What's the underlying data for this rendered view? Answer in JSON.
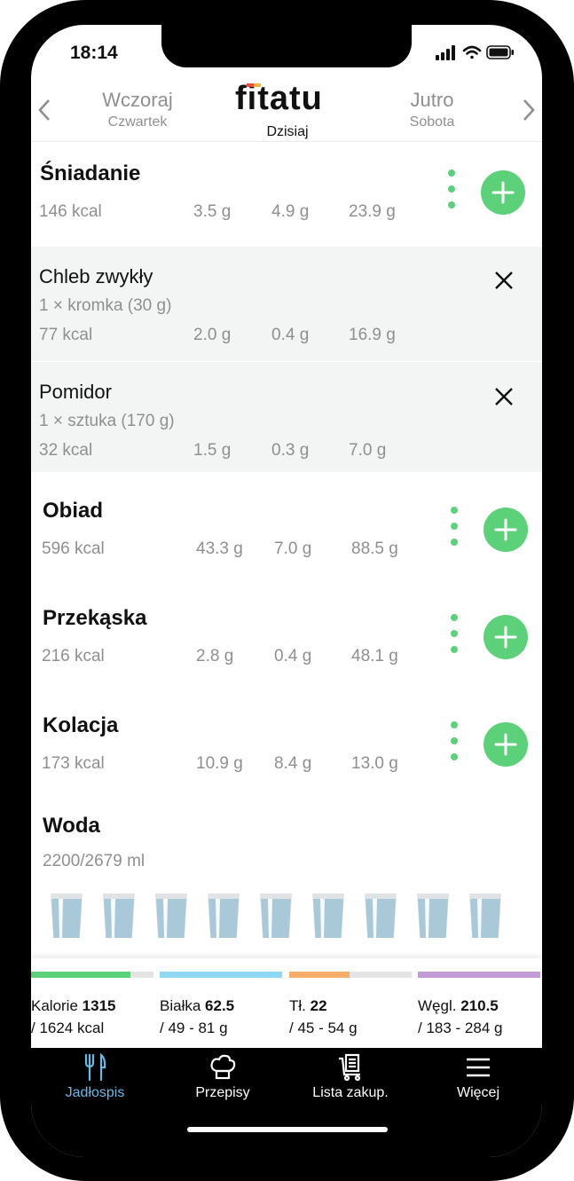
{
  "status_bar": {
    "time": "18:14"
  },
  "header": {
    "prev_day": {
      "name": "Wczoraj",
      "sub": "Czwartek"
    },
    "next_day": {
      "name": "Jutro",
      "sub": "Sobota"
    },
    "logo_text": "fitatu",
    "today_label": "Dzisiaj"
  },
  "meals": {
    "breakfast": {
      "title": "Śniadanie",
      "kcal": "146 kcal",
      "protein": "3.5 g",
      "fat": "4.9 g",
      "carbs": "23.9 g"
    },
    "lunch": {
      "title": "Obiad",
      "kcal": "596 kcal",
      "protein": "43.3 g",
      "fat": "7.0 g",
      "carbs": "88.5 g"
    },
    "snack": {
      "title": "Przekąska",
      "kcal": "216 kcal",
      "protein": "2.8 g",
      "fat": "0.4 g",
      "carbs": "48.1 g"
    },
    "dinner": {
      "title": "Kolacja",
      "kcal": "173 kcal",
      "protein": "10.9 g",
      "fat": "8.4 g",
      "carbs": "13.0 g"
    }
  },
  "breakfast_items": [
    {
      "name": "Chleb zwykły",
      "portion": "1 × kromka (30 g)",
      "kcal": "77 kcal",
      "protein": "2.0 g",
      "fat": "0.4 g",
      "carbs": "16.9 g"
    },
    {
      "name": "Pomidor",
      "portion": "1 × sztuka (170 g)",
      "kcal": "32 kcal",
      "protein": "1.5 g",
      "fat": "0.3 g",
      "carbs": "7.0 g"
    }
  ],
  "water": {
    "title": "Woda",
    "value": "2200/2679 ml",
    "glasses_total": 9,
    "glasses_filled": 9
  },
  "summary": {
    "calories": {
      "label": "Kalorie",
      "value": "1315",
      "range": "/ 1624 kcal",
      "progress": 0.81,
      "color": "#5dd07a"
    },
    "protein": {
      "label": "Białka",
      "value": "62.5",
      "range": "/ 49 - 81 g",
      "progress": 1.0,
      "color": "#8ed8f5"
    },
    "fat": {
      "label": "Tł.",
      "value": "22",
      "range": "/ 45 - 54 g",
      "progress": 0.49,
      "color": "#f6ad6c"
    },
    "carbs": {
      "label": "Węgl.",
      "value": "210.5",
      "range": "/ 183 - 284 g",
      "progress": 1.0,
      "color": "#c39ad8"
    }
  },
  "tabs": [
    {
      "label": "Jadłospis",
      "icon": "fork-knife-icon",
      "active": true
    },
    {
      "label": "Przepisy",
      "icon": "chef-hat-icon",
      "active": false
    },
    {
      "label": "Lista zakup.",
      "icon": "shopping-cart-icon",
      "active": false
    },
    {
      "label": "Więcej",
      "icon": "menu-icon",
      "active": false
    }
  ],
  "colors": {
    "accent": "#5dd07a",
    "active_tab": "#6ab8e6",
    "muted_text": "#8f8f8f"
  }
}
